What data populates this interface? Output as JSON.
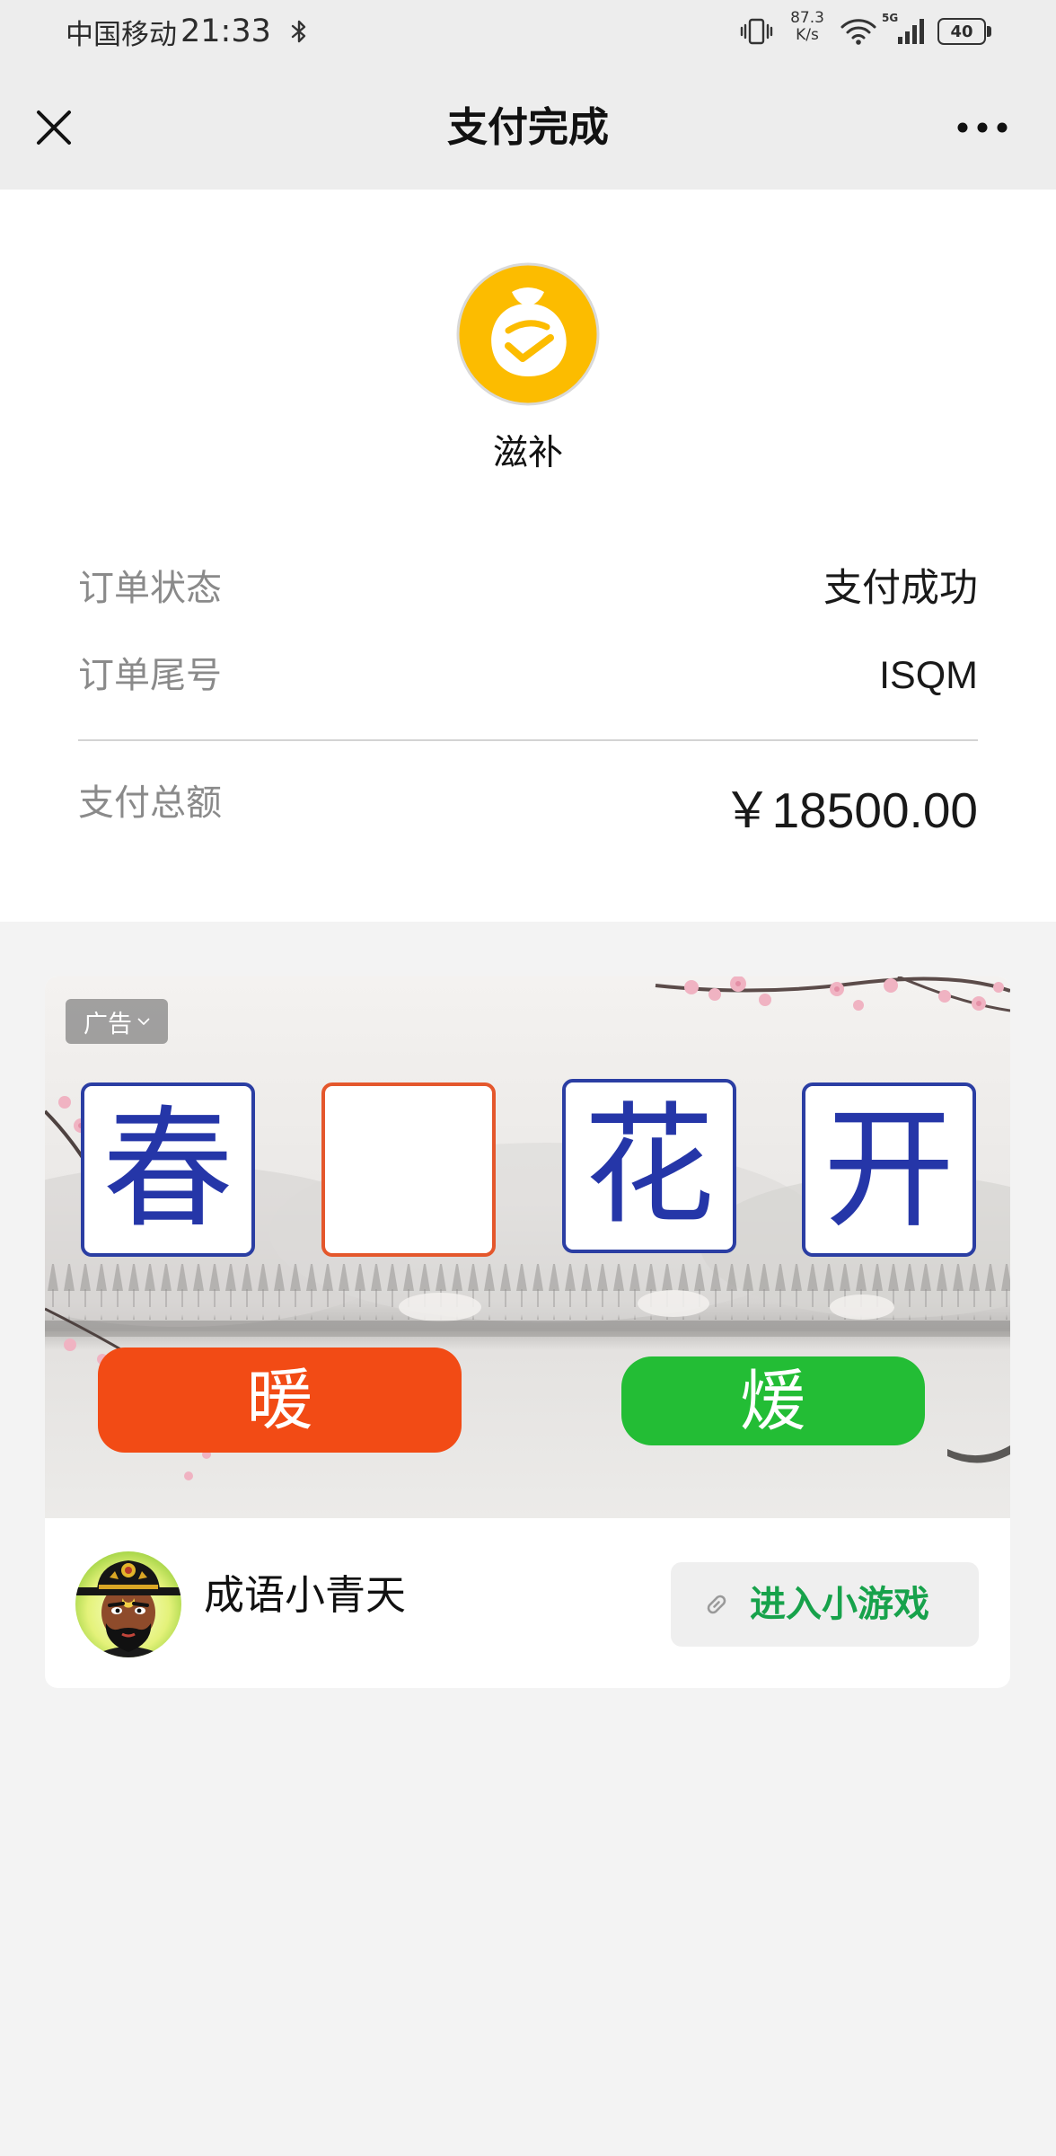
{
  "status_bar": {
    "carrier": "中国移动",
    "time": "21:33",
    "speed_value": "87.3",
    "speed_unit": "K/s",
    "network": "5G",
    "battery": "40",
    "icons": [
      "bluetooth-icon",
      "vibrate-icon",
      "wifi-icon",
      "signal-icon",
      "battery-icon"
    ]
  },
  "nav": {
    "title": "支付完成",
    "left_icon": "close-icon",
    "right_icon": "more-icon"
  },
  "merchant": {
    "name": "滋补",
    "logo_icon": "money-bag-check-icon"
  },
  "order": {
    "rows": [
      {
        "label": "订单状态",
        "value": "支付成功"
      },
      {
        "label": "订单尾号",
        "value": "ISQM"
      }
    ],
    "total": {
      "label": "支付总额",
      "value": "￥18500.00"
    }
  },
  "ad": {
    "tag": "广告",
    "tag_icon": "chevron-down-icon",
    "puzzle": {
      "chars": [
        "春",
        "",
        "花",
        "开"
      ],
      "options": [
        "暖",
        "煖"
      ]
    },
    "app": {
      "name": "成语小青天",
      "avatar_icon": "judge-character-avatar",
      "cta": "进入小游戏",
      "cta_icon": "link-icon"
    }
  },
  "colors": {
    "header_bg": "#ededed",
    "page_bg": "#f3f3f3",
    "logo": "#fcbc00",
    "puzzle_char": "#2536a8",
    "puzzle_border": "#2b3ea3",
    "puzzle_blank_border": "#e4572c",
    "option_left": "#f24b15",
    "option_right": "#23bd35",
    "cta_text": "#17a24b"
  }
}
